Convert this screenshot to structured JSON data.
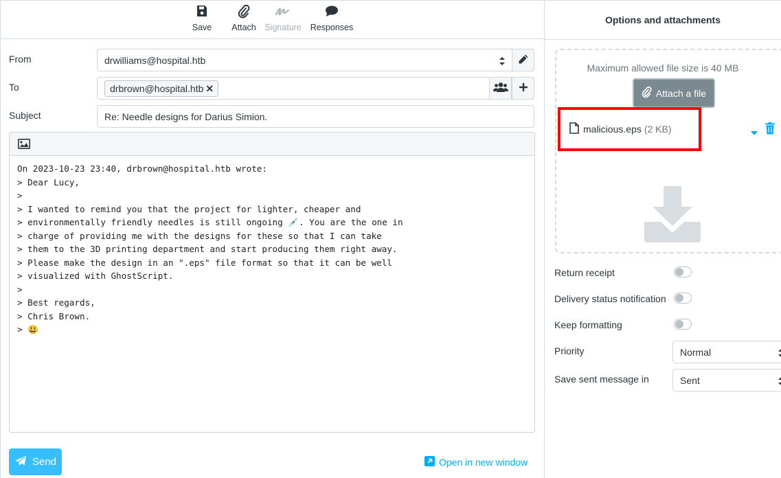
{
  "toolbar": {
    "save_label": "Save",
    "attach_label": "Attach",
    "signature_label": "Signature",
    "responses_label": "Responses"
  },
  "compose": {
    "from_label": "From",
    "from_value": "drwilliams@hospital.htb",
    "to_label": "To",
    "to_recipient": "drbrown@hospital.htb",
    "subject_label": "Subject",
    "subject_value": "Re: Needle designs for Darius Simion.",
    "body_lines": [
      "On 2023-10-23 23:40, drbrown@hospital.htb wrote:",
      "> Dear Lucy,",
      ">",
      "> I wanted to remind you that the project for lighter, cheaper and",
      "> environmentally friendly needles is still ongoing 💉. You are the one in",
      "> charge of providing me with the designs for these so that I can take",
      "> them to the 3D printing department and start producing them right away.",
      "> Please make the design in an \".eps\" file format so that it can be well",
      "> visualized with GhostScript.",
      ">",
      "> Best regards,",
      "> Chris Brown.",
      "> 😃"
    ],
    "send_label": "Send",
    "open_new_window_label": "Open in new window"
  },
  "options": {
    "title": "Options and attachments",
    "max_size_text": "Maximum allowed file size is 40 MB",
    "attach_file_label": "Attach a file",
    "attachment": {
      "name": "malicious.eps",
      "size": "(2 KB)"
    },
    "return_receipt_label": "Return receipt",
    "return_receipt_on": false,
    "dsn_label": "Delivery status notification",
    "dsn_on": false,
    "keep_formatting_label": "Keep formatting",
    "keep_formatting_on": false,
    "priority_label": "Priority",
    "priority_value": "Normal",
    "save_sent_label": "Save sent message in",
    "save_sent_value": "Sent"
  },
  "colors": {
    "accent": "#37beff",
    "link": "#00acff",
    "highlight": "#ff0000",
    "attach_button": "#7b8a91"
  },
  "icons": [
    "save-icon",
    "paperclip-icon",
    "signature-icon",
    "comment-icon",
    "pencil-icon",
    "users-icon",
    "plus-icon",
    "image-icon",
    "paper-plane-icon",
    "external-link-icon",
    "file-icon",
    "caret-down-icon",
    "trash-icon",
    "download-icon"
  ]
}
